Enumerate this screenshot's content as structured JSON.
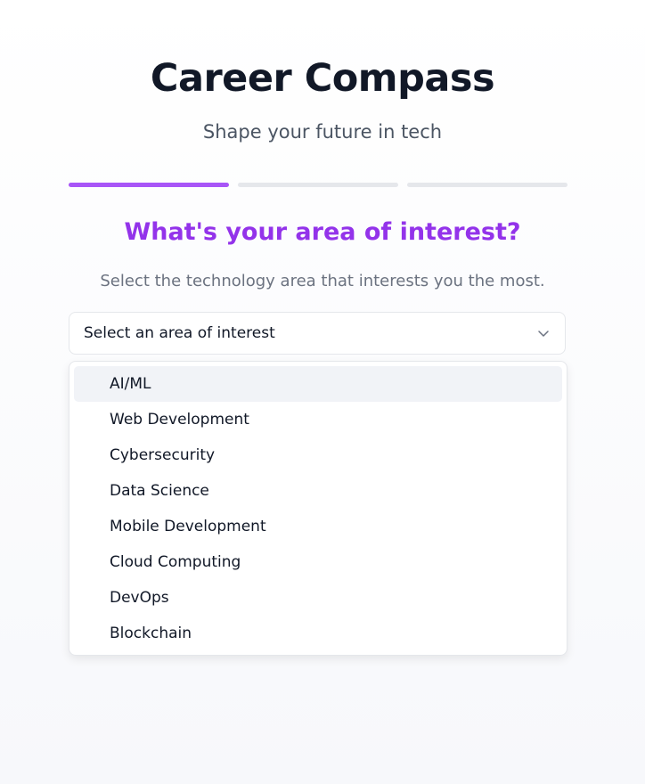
{
  "header": {
    "title": "Career Compass",
    "subtitle": "Shape your future in tech"
  },
  "progress": {
    "total_steps": 3,
    "current_step": 1
  },
  "step": {
    "question": "What's your area of interest?",
    "instruction": "Select the technology area that interests you the most."
  },
  "select": {
    "placeholder": "Select an area of interest",
    "icon": "chevron-down-icon",
    "options": [
      "AI/ML",
      "Web Development",
      "Cybersecurity",
      "Data Science",
      "Mobile Development",
      "Cloud Computing",
      "DevOps",
      "Blockchain"
    ],
    "highlighted_option": "AI/ML"
  },
  "colors": {
    "accent": "#9333ea",
    "progress_active": "#a855f7",
    "progress_inactive": "#e5e7eb",
    "option_highlight": "#f1f3f7"
  }
}
